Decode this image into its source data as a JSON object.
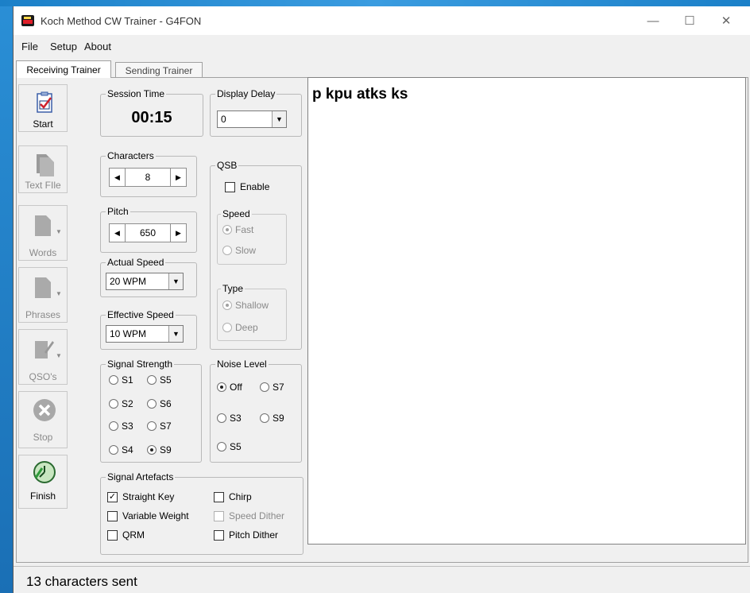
{
  "window": {
    "title": "Koch Method CW Trainer - G4FON",
    "controls": [
      "—",
      "☐",
      "✕"
    ]
  },
  "menu": [
    "File",
    "Setup",
    "About"
  ],
  "tabs": [
    "Receiving Trainer",
    "Sending Trainer"
  ],
  "toolbar": {
    "start": "Start",
    "text_file": "Text FIle",
    "words": "Words",
    "phrases": "Phrases",
    "qsos": "QSO's",
    "stop": "Stop",
    "finish": "Finish"
  },
  "session_time": {
    "label": "Session Time",
    "value": "00:15"
  },
  "display_delay": {
    "label": "Display Delay",
    "value": "0"
  },
  "characters": {
    "label": "Characters",
    "value": "8"
  },
  "pitch": {
    "label": "Pitch",
    "value": "650"
  },
  "actual_speed": {
    "label": "Actual Speed",
    "value": "20 WPM"
  },
  "effective_speed": {
    "label": "Effective Speed",
    "value": "10 WPM"
  },
  "qsb": {
    "label": "QSB",
    "enable": "Enable",
    "enabled": false,
    "speed": {
      "label": "Speed",
      "options": [
        "Fast",
        "Slow"
      ],
      "selected": "Fast"
    },
    "type": {
      "label": "Type",
      "options": [
        "Shallow",
        "Deep"
      ],
      "selected": "Shallow"
    }
  },
  "signal_strength": {
    "label": "Signal Strength",
    "options": [
      "S1",
      "S5",
      "S2",
      "S6",
      "S3",
      "S7",
      "S4",
      "S9"
    ],
    "selected": "S9"
  },
  "noise_level": {
    "label": "Noise Level",
    "options": [
      "Off",
      "S7",
      "S3",
      "S9",
      "S5"
    ],
    "selected": "Off"
  },
  "signal_artefacts": {
    "label": "Signal Artefacts",
    "straight_key": "Straight Key",
    "variable_weight": "Variable Weight",
    "qrm": "QRM",
    "chirp": "Chirp",
    "speed_dither": "Speed Dither",
    "pitch_dither": "Pitch Dither",
    "checked": [
      "Straight Key"
    ]
  },
  "arrows": {
    "left": "◀",
    "right": "▶",
    "down": "▼"
  },
  "output_text": "p kpu atks ks",
  "status": "13 characters sent"
}
